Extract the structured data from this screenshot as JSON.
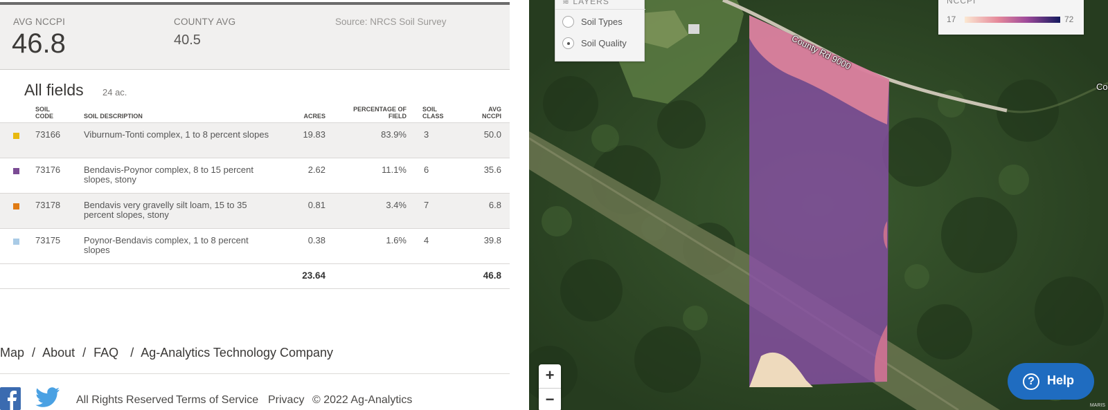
{
  "stats": {
    "avg_label": "AVG NCCPI",
    "avg_value": "46.8",
    "county_label": "COUNTY AVG",
    "county_value": "40.5",
    "source": "Source: NRCS Soil Survey"
  },
  "fields": {
    "title": "All fields",
    "acres": "24 ac."
  },
  "table": {
    "headers": {
      "soil_code": "SOIL CODE",
      "soil_description": "SOIL DESCRIPTION",
      "acres": "ACRES",
      "percentage": "PERCENTAGE OF FIELD",
      "soil_class": "SOIL CLASS",
      "avg_nccpi": "AVG NCCPI"
    },
    "rows": [
      {
        "color": "#e8b90f",
        "code": "73166",
        "description": "Viburnum-Tonti complex, 1 to 8 percent slopes",
        "acres": "19.83",
        "percentage": "83.9%",
        "soil_class": "3",
        "nccpi": "50.0"
      },
      {
        "color": "#7b4b94",
        "code": "73176",
        "description": "Bendavis-Poynor complex, 8 to 15 percent slopes, stony",
        "acres": "2.62",
        "percentage": "11.1%",
        "soil_class": "6",
        "nccpi": "35.6"
      },
      {
        "color": "#e07b14",
        "code": "73178",
        "description": "Bendavis very gravelly silt loam, 15 to 35 percent slopes, stony",
        "acres": "0.81",
        "percentage": "3.4%",
        "soil_class": "7",
        "nccpi": "6.8"
      },
      {
        "color": "#a9cbe6",
        "code": "73175",
        "description": "Poynor-Bendavis complex, 1 to 8 percent slopes",
        "acres": "0.38",
        "percentage": "1.6%",
        "soil_class": "4",
        "nccpi": "39.8"
      }
    ],
    "total_acres": "23.64",
    "total_nccpi": "46.8"
  },
  "footer": {
    "nav": [
      "Map",
      "/",
      "About",
      "/",
      "FAQ",
      "/",
      "Ag-Analytics Technology Company"
    ],
    "rights": "All Rights Reserved",
    "terms": "Terms of Service",
    "privacy": "Privacy",
    "copyright": "© 2022 Ag-Analytics",
    "icons": [
      "facebook-icon",
      "twitter-icon"
    ]
  },
  "map": {
    "layers_title": "LAYERS",
    "layer_options": [
      {
        "label": "Soil Types",
        "selected": false
      },
      {
        "label": "Soil Quality",
        "selected": true
      }
    ],
    "legend_title": "NCCPI",
    "legend_min": "17",
    "legend_max": "72",
    "road_label": "County Rd 9000",
    "road_label_2": "Co",
    "zoom_in": "+",
    "zoom_out": "−",
    "help_label": "Help",
    "help_icon": "?",
    "attribution": "MARIS"
  }
}
